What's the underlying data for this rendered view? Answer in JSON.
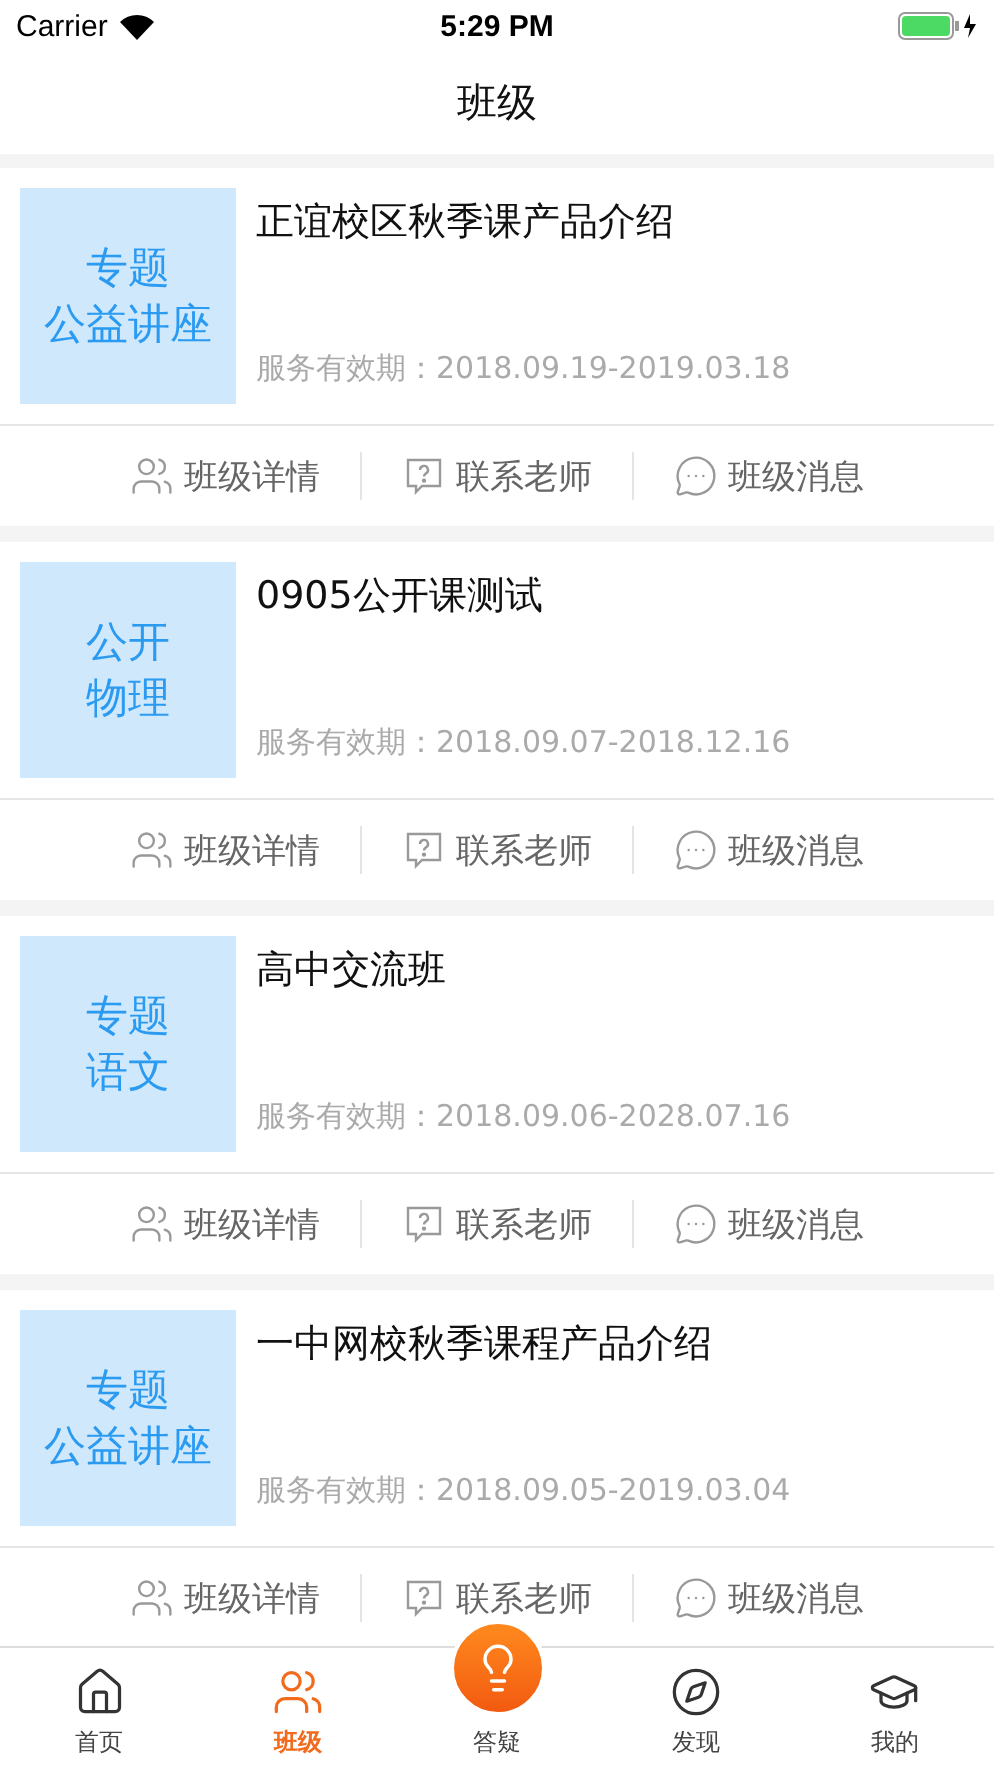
{
  "status_bar": {
    "carrier": "Carrier",
    "time": "5:29 PM"
  },
  "nav": {
    "title": "班级"
  },
  "classes": [
    {
      "thumb_lines": [
        "专题",
        "公益讲座"
      ],
      "title": "正谊校区秋季课产品介绍",
      "validity": "服务有效期：2018.09.19-2019.03.18",
      "actions": [
        {
          "kind": "details",
          "label": "班级详情"
        },
        {
          "kind": "contact",
          "label": "联系老师"
        },
        {
          "kind": "messages",
          "label": "班级消息"
        }
      ]
    },
    {
      "thumb_lines": [
        "公开",
        "物理"
      ],
      "title": "0905公开课测试",
      "validity": "服务有效期：2018.09.07-2018.12.16",
      "actions": [
        {
          "kind": "details",
          "label": "班级详情"
        },
        {
          "kind": "contact",
          "label": "联系老师"
        },
        {
          "kind": "messages",
          "label": "班级消息"
        }
      ]
    },
    {
      "thumb_lines": [
        "专题",
        "语文"
      ],
      "title": "高中交流班",
      "validity": "服务有效期：2018.09.06-2028.07.16",
      "actions": [
        {
          "kind": "details",
          "label": "班级详情"
        },
        {
          "kind": "contact",
          "label": "联系老师"
        },
        {
          "kind": "messages",
          "label": "班级消息"
        }
      ]
    },
    {
      "thumb_lines": [
        "专题",
        "公益讲座"
      ],
      "title": "一中网校秋季课程产品介绍",
      "validity": "服务有效期：2018.09.05-2019.03.04",
      "actions": [
        {
          "kind": "details",
          "label": "班级详情"
        },
        {
          "kind": "contact",
          "label": "联系老师"
        },
        {
          "kind": "messages",
          "label": "班级消息"
        }
      ]
    }
  ],
  "tab_bar": [
    {
      "kind": "home",
      "label": "首页",
      "selected": false
    },
    {
      "kind": "class",
      "label": "班级",
      "selected": true
    },
    {
      "kind": "center",
      "label": "答疑",
      "selected": false
    },
    {
      "kind": "discover",
      "label": "发现",
      "selected": false
    },
    {
      "kind": "mine",
      "label": "我的",
      "selected": false
    }
  ]
}
